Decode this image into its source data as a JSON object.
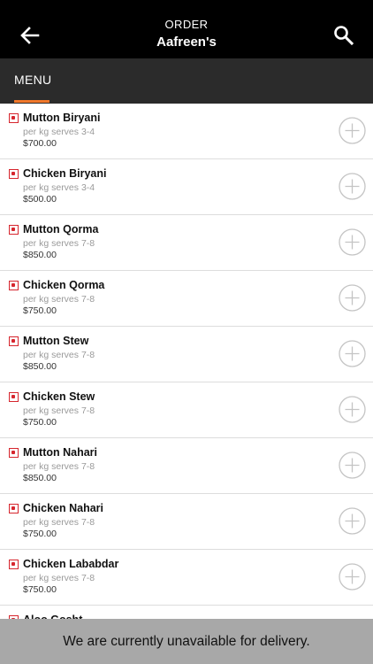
{
  "header": {
    "back_icon": "arrow-left-icon",
    "subtitle": "ORDER",
    "title": "Aafreen's",
    "search_icon": "search-icon"
  },
  "tabs": [
    {
      "label": "MENU",
      "active": true
    }
  ],
  "colors": {
    "header_bg": "#000000",
    "tab_bar_bg": "#2b2b2b",
    "tab_indicator": "#f0772a",
    "item_marker": "#d6262e",
    "banner_bg": "#a8a8a8"
  },
  "menu_items": [
    {
      "name": "Mutton Biryani",
      "desc": "per kg serves 3-4",
      "price": "$700.00"
    },
    {
      "name": "Chicken Biryani",
      "desc": "per kg serves 3-4",
      "price": "$500.00"
    },
    {
      "name": "Mutton Qorma",
      "desc": "per kg serves 7-8",
      "price": "$850.00"
    },
    {
      "name": "Chicken Qorma",
      "desc": "per kg serves 7-8",
      "price": "$750.00"
    },
    {
      "name": "Mutton Stew",
      "desc": "per kg serves 7-8",
      "price": "$850.00"
    },
    {
      "name": "Chicken Stew",
      "desc": "per kg serves 7-8",
      "price": "$750.00"
    },
    {
      "name": "Mutton Nahari",
      "desc": "per kg serves 7-8",
      "price": "$850.00"
    },
    {
      "name": "Chicken Nahari",
      "desc": "per kg serves 7-8",
      "price": "$750.00"
    },
    {
      "name": "Chicken Lababdar",
      "desc": "per kg serves 7-8",
      "price": "$750.00"
    },
    {
      "name": "Aloo Gosht",
      "desc": "",
      "price": ""
    }
  ],
  "add_icon": "plus-circle-icon",
  "banner": {
    "text": "We are currently unavailable for delivery."
  }
}
